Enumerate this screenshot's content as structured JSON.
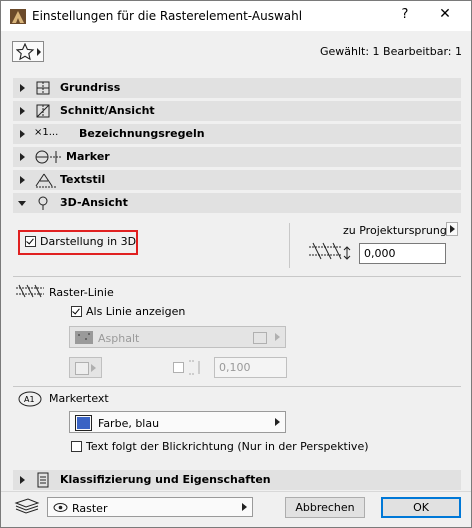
{
  "window": {
    "title": "Einstellungen für die Rasterelement-Auswahl",
    "help_label": "?",
    "close_label": "✕"
  },
  "header": {
    "favorites_icon": "star-icon",
    "selection_info": "Gewählt: 1 Bearbeitbar: 1"
  },
  "sections": [
    {
      "label": "Grundriss",
      "icon": "grid-plan-icon",
      "expanded": false
    },
    {
      "label": "Schnitt/Ansicht",
      "icon": "grid-section-icon",
      "expanded": false
    },
    {
      "label": "Bezeichnungsregeln",
      "icon": "naming-icon",
      "icon_text": "×1...",
      "expanded": false
    },
    {
      "label": "Marker",
      "icon": "marker-icon",
      "expanded": false
    },
    {
      "label": "Textstil",
      "icon": "text-style-icon",
      "expanded": false
    },
    {
      "label": "3D-Ansicht",
      "icon": "3d-view-icon",
      "expanded": true
    }
  ],
  "view3d": {
    "show_in_3d_label": "Darstellung in 3D",
    "show_in_3d_checked": true,
    "origin_label": "zu Projektursprung",
    "elevation_value": "0,000"
  },
  "raster_line": {
    "title": "Raster-Linie",
    "show_as_line_label": "Als Linie anzeigen",
    "show_as_line_checked": true,
    "surface_value": "Asphalt",
    "thickness_value": "0,100"
  },
  "marker_text": {
    "title": "Markertext",
    "color_value": "Farbe, blau",
    "color_swatch": "#3a63c4",
    "follow_label": "Text folgt der Blickrichtung (Nur in der Perspektive)",
    "follow_checked": false
  },
  "classification": {
    "label": "Klassifizierung und Eigenschaften"
  },
  "footer": {
    "layer_value": "Raster",
    "cancel_label": "Abbrechen",
    "ok_label": "OK"
  },
  "colors": {
    "accent": "#0078d7",
    "highlight": "#e02020"
  }
}
